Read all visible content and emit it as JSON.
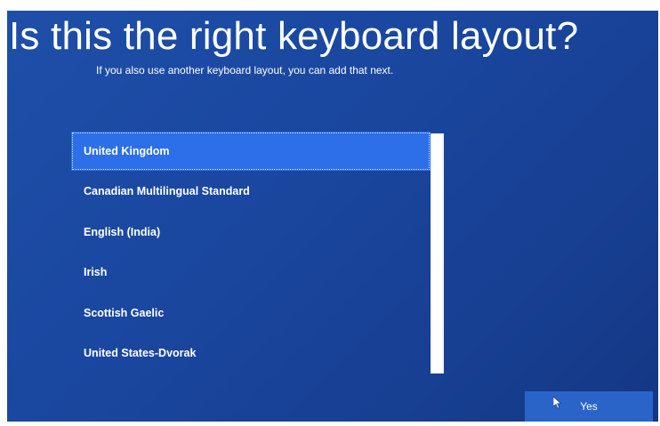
{
  "header": {
    "title": "Is this the right keyboard layout?",
    "subtitle": "If you also use another keyboard layout, you can add that next."
  },
  "layouts": {
    "selected": "United Kingdom",
    "items": [
      "United Kingdom",
      "Canadian Multilingual Standard",
      "English (India)",
      "Irish",
      "Scottish Gaelic",
      "United States-Dvorak"
    ]
  },
  "footer": {
    "yes_label": "Yes"
  },
  "colors": {
    "background": "#1a47a0",
    "selected": "#2d6fe8",
    "button": "#2a64c9",
    "text": "#ffffff"
  },
  "icons": {
    "cursor": "mouse-pointer-icon"
  }
}
